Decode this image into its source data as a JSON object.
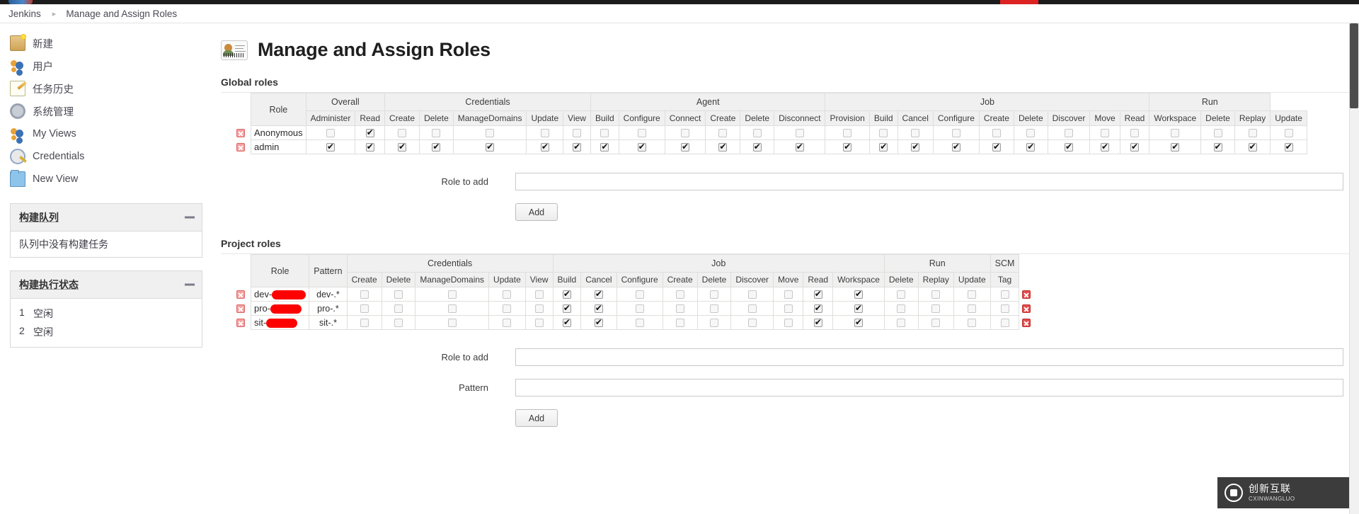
{
  "breadcrumb": {
    "root": "Jenkins",
    "separator": "▸",
    "current": "Manage and Assign Roles"
  },
  "sidebar": {
    "items": [
      {
        "label": "新建",
        "icon": "new-item-icon"
      },
      {
        "label": "用户",
        "icon": "people-icon"
      },
      {
        "label": "任务历史",
        "icon": "build-history-icon"
      },
      {
        "label": "系统管理",
        "icon": "gear-icon"
      },
      {
        "label": "My Views",
        "icon": "people-icon"
      },
      {
        "label": "Credentials",
        "icon": "credentials-icon"
      },
      {
        "label": "New View",
        "icon": "folder-icon"
      }
    ],
    "build_queue": {
      "title": "构建队列",
      "empty_text": "队列中没有构建任务"
    },
    "build_executor": {
      "title": "构建执行状态",
      "executors": [
        {
          "num": "1",
          "state": "空闲"
        },
        {
          "num": "2",
          "state": "空闲"
        }
      ]
    }
  },
  "main": {
    "title": "Manage and Assign Roles",
    "global_section_title": "Global roles",
    "project_section_title": "Project roles"
  },
  "global_table": {
    "role_header": "Role",
    "groups": [
      {
        "label": "Overall",
        "span": 2
      },
      {
        "label": "Credentials",
        "span": 5
      },
      {
        "label": "Agent",
        "span": 6
      },
      {
        "label": "Job",
        "span": 9
      },
      {
        "label": "Run",
        "span": 3
      }
    ],
    "permissions": [
      "Administer",
      "Read",
      "Create",
      "Delete",
      "ManageDomains",
      "Update",
      "View",
      "Build",
      "Configure",
      "Connect",
      "Create",
      "Delete",
      "Disconnect",
      "Provision",
      "Build",
      "Cancel",
      "Configure",
      "Create",
      "Delete",
      "Discover",
      "Move",
      "Read",
      "Workspace",
      "Delete",
      "Replay",
      "Update"
    ],
    "rows": [
      {
        "name": "Anonymous",
        "checks": [
          false,
          true,
          false,
          false,
          false,
          false,
          false,
          false,
          false,
          false,
          false,
          false,
          false,
          false,
          false,
          false,
          false,
          false,
          false,
          false,
          false,
          false,
          false,
          false,
          false,
          false
        ]
      },
      {
        "name": "admin",
        "checks": [
          true,
          true,
          true,
          true,
          true,
          true,
          true,
          true,
          true,
          true,
          true,
          true,
          true,
          true,
          true,
          true,
          true,
          true,
          true,
          true,
          true,
          true,
          true,
          true,
          true,
          true
        ]
      }
    ]
  },
  "global_add": {
    "role_label": "Role to add",
    "role_value": "",
    "add_label": "Add"
  },
  "project_table": {
    "role_header": "Role",
    "pattern_header": "Pattern",
    "groups": [
      {
        "label": "Credentials",
        "span": 5
      },
      {
        "label": "Job",
        "span": 9
      },
      {
        "label": "Run",
        "span": 3
      },
      {
        "label": "SCM",
        "span": 1
      }
    ],
    "permissions": [
      "Create",
      "Delete",
      "ManageDomains",
      "Update",
      "View",
      "Build",
      "Cancel",
      "Configure",
      "Create",
      "Delete",
      "Discover",
      "Move",
      "Read",
      "Workspace",
      "Delete",
      "Replay",
      "Update",
      "Tag"
    ],
    "rows": [
      {
        "name_prefix": "dev-",
        "name_redacted": true,
        "redact_width": 48,
        "pattern": "dev-.*",
        "checks": [
          false,
          false,
          false,
          false,
          false,
          true,
          true,
          false,
          false,
          false,
          false,
          false,
          true,
          true,
          false,
          false,
          false,
          false
        ]
      },
      {
        "name_prefix": "pro-",
        "name_redacted": true,
        "redact_width": 44,
        "pattern": "pro-.*",
        "checks": [
          false,
          false,
          false,
          false,
          false,
          true,
          true,
          false,
          false,
          false,
          false,
          false,
          true,
          true,
          false,
          false,
          false,
          false
        ]
      },
      {
        "name_prefix": "sit-",
        "name_redacted": true,
        "redact_width": 44,
        "pattern": "sit-.*",
        "checks": [
          false,
          false,
          false,
          false,
          false,
          true,
          true,
          false,
          false,
          false,
          false,
          false,
          true,
          true,
          false,
          false,
          false,
          false
        ]
      }
    ]
  },
  "project_add": {
    "role_label": "Role to add",
    "role_value": "",
    "pattern_label": "Pattern",
    "pattern_value": "",
    "add_label": "Add"
  },
  "watermark": {
    "cn": "创新互联",
    "en": "CXINWANGLUO"
  },
  "colors": {
    "accent": "#fe0000",
    "header_bg": "#f0f0f0",
    "border": "#dededb"
  }
}
